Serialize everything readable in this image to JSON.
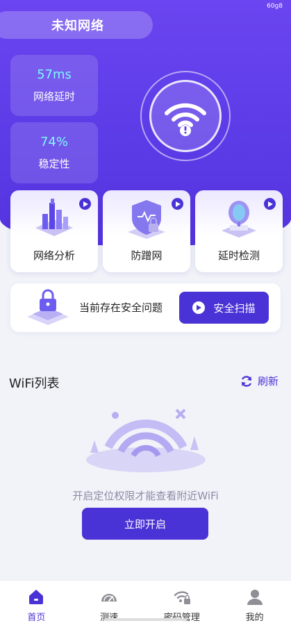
{
  "status_bar": {
    "text": "60g8"
  },
  "network": {
    "name": "未知网络"
  },
  "stats": [
    {
      "value": "57ms",
      "label": "网络延时"
    },
    {
      "value": "74%",
      "label": "稳定性"
    }
  ],
  "features": [
    {
      "label": "网络分析",
      "icon": "bar-analysis-icon"
    },
    {
      "label": "防蹭网",
      "icon": "shield-lock-icon"
    },
    {
      "label": "延时检测",
      "icon": "speed-globe-icon"
    }
  ],
  "safety": {
    "text": "当前存在安全问题",
    "button_label": "安全扫描"
  },
  "wifi_list": {
    "title": "WiFi列表",
    "refresh_label": "刷新"
  },
  "empty_state": {
    "hint": "开启定位权限才能查看附近WiFi",
    "button_label": "立即开启"
  },
  "tabs": [
    {
      "label": "首页",
      "icon": "home-icon",
      "active": true
    },
    {
      "label": "测速",
      "icon": "speedometer-icon",
      "active": false
    },
    {
      "label": "密码管理",
      "icon": "wifi-lock-icon",
      "active": false
    },
    {
      "label": "我的",
      "icon": "user-icon",
      "active": false
    }
  ],
  "colors": {
    "primary": "#4a33d6",
    "hero": "#5b3be6",
    "accent_value": "#7ef7ff"
  }
}
